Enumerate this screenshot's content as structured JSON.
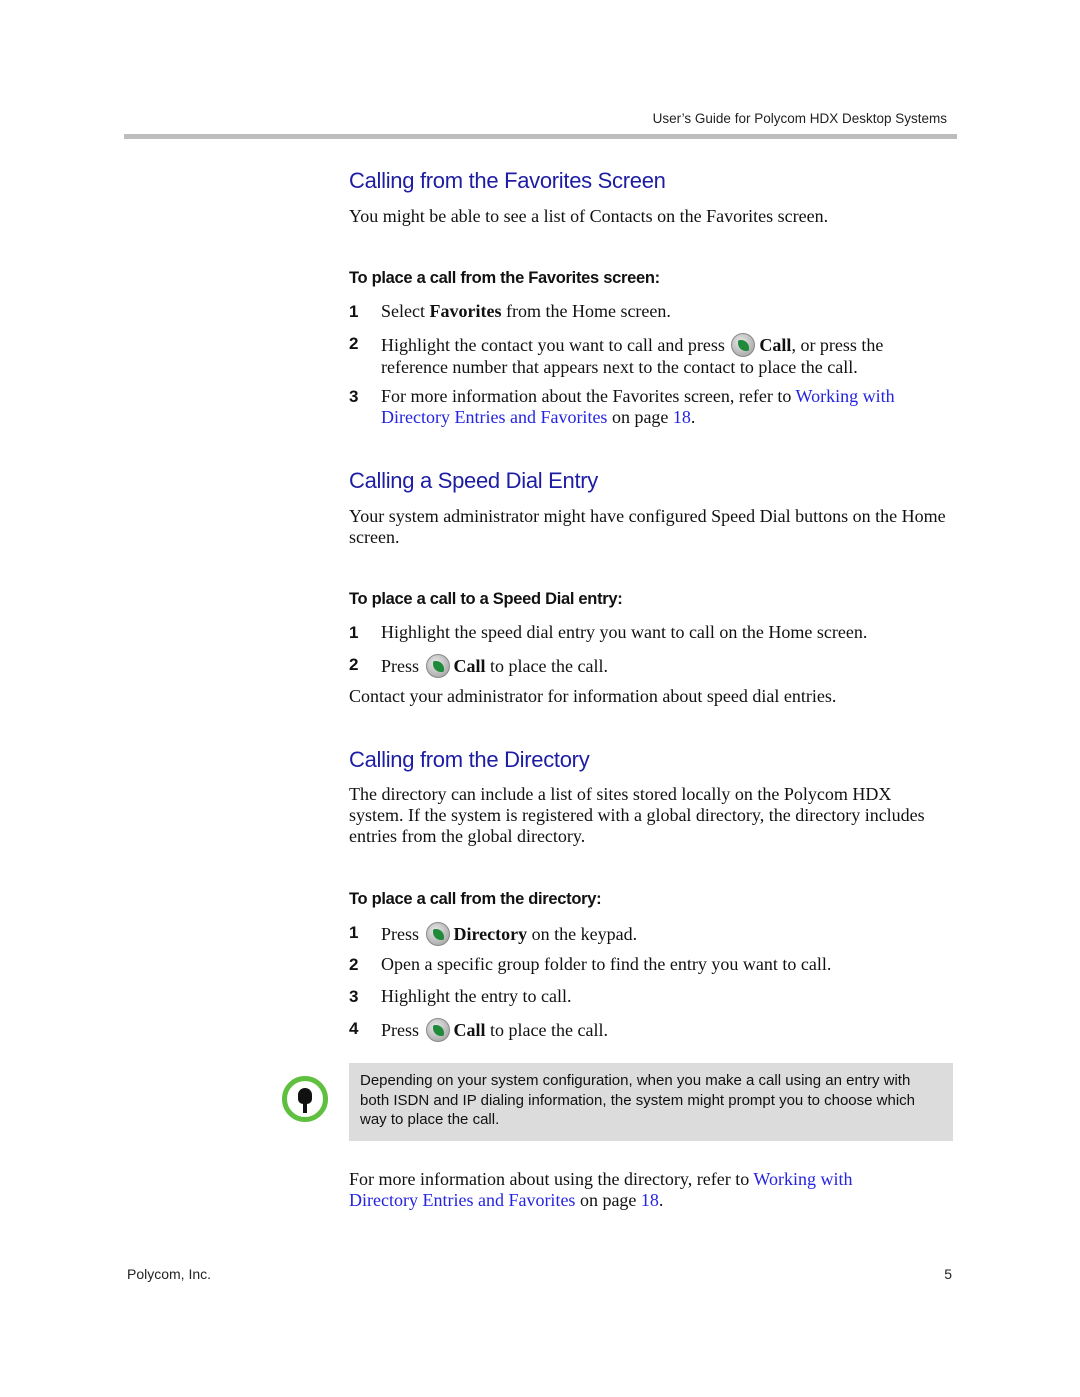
{
  "header": {
    "running_title": "User’s Guide for Polycom HDX Desktop Systems"
  },
  "sections": [
    {
      "title": "Calling from the Favorites Screen",
      "intro": "You might be able to see a list of Contacts on the Favorites screen.",
      "procedure_title": "To place a call from the Favorites screen:",
      "steps": [
        {
          "n": "1",
          "pre": "Select ",
          "bold": "Favorites",
          "post": " from the Home screen."
        },
        {
          "n": "2",
          "pre": "Highlight the contact you want to call and press ",
          "icon": "call-icon",
          "bold": "Call",
          "post": ", or press the reference number that appears next to the contact to place the call."
        },
        {
          "n": "3",
          "pre": "For more information about the Favorites screen, refer to ",
          "link": "Working with Directory Entries and Favorites",
          "mid": " on page ",
          "page": "18",
          "post": "."
        }
      ]
    },
    {
      "title": "Calling a Speed Dial Entry",
      "intro": "Your system administrator might have configured Speed Dial buttons on the Home screen.",
      "procedure_title": "To place a call to a Speed Dial entry:",
      "steps": [
        {
          "n": "1",
          "pre": "Highlight the speed dial entry you want to call on the Home screen."
        },
        {
          "n": "2",
          "pre": "Press ",
          "icon": "call-icon",
          "bold": "Call",
          "post": " to place the call."
        }
      ],
      "outro": "Contact your administrator for information about speed dial entries."
    },
    {
      "title": "Calling from the Directory",
      "intro": "The directory can include a list of sites stored locally on the Polycom HDX system. If the system is registered with a global directory, the directory includes entries from the global directory.",
      "procedure_title": "To place a call from the directory:",
      "steps": [
        {
          "n": "1",
          "pre": "Press ",
          "icon": "directory-icon",
          "bold": "Directory",
          "post": " on the keypad."
        },
        {
          "n": "2",
          "pre": "Open a specific group folder to find the entry you want to call."
        },
        {
          "n": "3",
          "pre": "Highlight the entry to call."
        },
        {
          "n": "4",
          "pre": "Press ",
          "icon": "call-icon",
          "bold": "Call",
          "post": " to place the call."
        }
      ],
      "note": "Depending on your system configuration, when you make a call using an entry with both ISDN and IP dialing information, the system might prompt you to choose which way to place the call.",
      "outro": {
        "pre": "For more information about using the directory, refer to ",
        "link": "Working with Directory Entries and Favorites",
        "mid": " on page ",
        "page": "18",
        "post": "."
      }
    }
  ],
  "footer": {
    "company": "Polycom, Inc.",
    "page_number": "5"
  },
  "colors": {
    "heading": "#1d1da3",
    "link": "#2323e0",
    "note_bg": "#dcdcdc",
    "note_icon": "#5fbf3f"
  }
}
